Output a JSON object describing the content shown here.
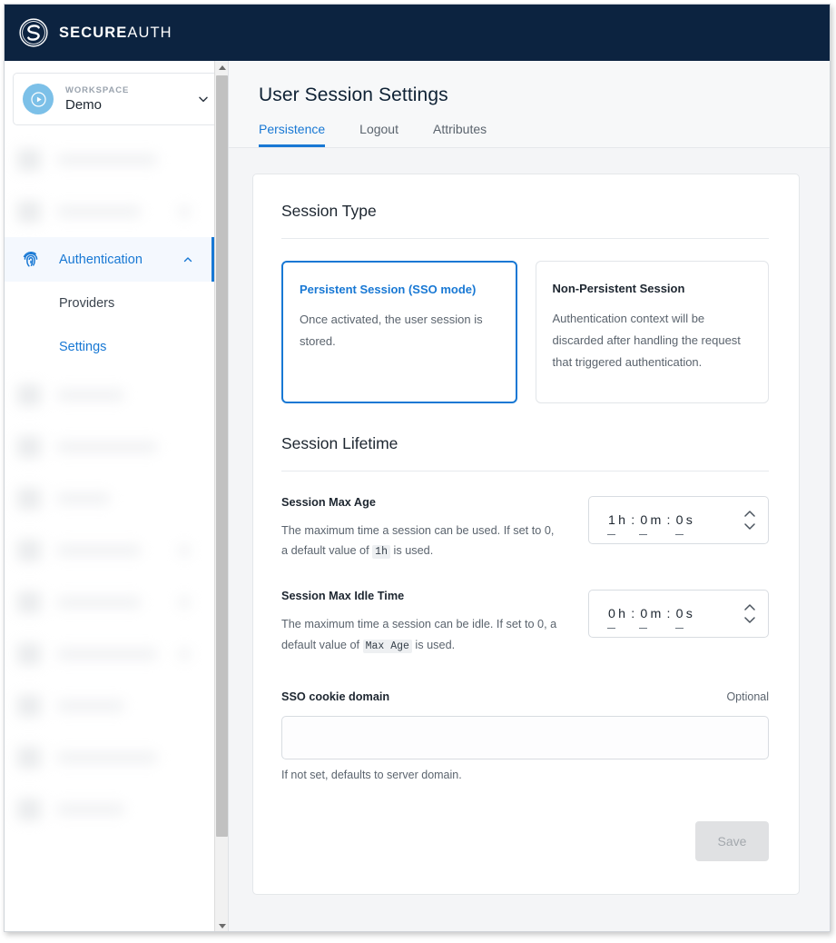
{
  "brand": {
    "name_bold": "SECURE",
    "name_light": "AUTH",
    "logo_icon": "secureauth-circle-s-logo"
  },
  "sidebar": {
    "workspace": {
      "label": "WORKSPACE",
      "name": "Demo",
      "avatar_icon": "play-circle-icon",
      "caret_icon": "chevron-down-icon",
      "avatar_color": "#7cc0e8"
    },
    "nav": {
      "active_item": {
        "label": "Authentication",
        "icon": "fingerprint-icon",
        "chevron_icon": "chevron-up-icon"
      },
      "sub_items": [
        {
          "label": "Providers",
          "selected": false
        },
        {
          "label": "Settings",
          "selected": true
        }
      ]
    },
    "scrollbar": {
      "up_arrow_icon": "scroll-up-arrow-icon",
      "down_arrow_icon": "scroll-down-arrow-icon"
    }
  },
  "header": {
    "title": "User Session Settings",
    "tabs": [
      {
        "label": "Persistence",
        "active": true
      },
      {
        "label": "Logout",
        "active": false
      },
      {
        "label": "Attributes",
        "active": false
      }
    ]
  },
  "session_type": {
    "title": "Session Type",
    "options": [
      {
        "title": "Persistent Session (SSO mode)",
        "description": "Once activated, the user session is stored.",
        "selected": true
      },
      {
        "title": "Non-Persistent Session",
        "description": "Authentication context will be discarded after handling the request that triggered authentication.",
        "selected": false
      }
    ]
  },
  "session_lifetime": {
    "title": "Session Lifetime",
    "max_age": {
      "label": "Session Max Age",
      "desc_part1": "The maximum time a session can be used. If set to 0, a default value of ",
      "desc_code": "1h",
      "desc_part2": " is used.",
      "hours": "1",
      "minutes": "0",
      "seconds": "0",
      "hours_unit": "h",
      "minutes_unit": "m",
      "seconds_unit": "s",
      "stepper_up_icon": "stepper-up-icon",
      "stepper_down_icon": "stepper-down-icon"
    },
    "max_idle": {
      "label": "Session Max Idle Time",
      "desc_part1": "The maximum time a session can be idle. If set to 0, a default value of ",
      "desc_code": "Max Age",
      "desc_part2": " is used.",
      "hours": "0",
      "minutes": "0",
      "seconds": "0",
      "hours_unit": "h",
      "minutes_unit": "m",
      "seconds_unit": "s",
      "stepper_up_icon": "stepper-up-icon",
      "stepper_down_icon": "stepper-down-icon"
    }
  },
  "cookie_domain": {
    "label": "SSO cookie domain",
    "optional_badge": "Optional",
    "value": "",
    "placeholder": "",
    "hint": "If not set, defaults to server domain."
  },
  "actions": {
    "save_label": "Save",
    "save_enabled": false
  },
  "colors": {
    "brand_navy": "#0c2340",
    "accent_blue": "#1878d4",
    "page_bg": "#f4f5f7",
    "text_dark": "#1d2630",
    "text_muted": "#5b646e"
  }
}
